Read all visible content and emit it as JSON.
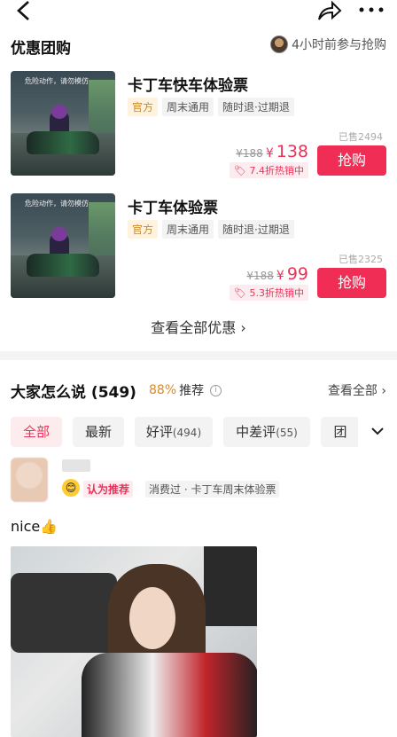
{
  "deals_section": {
    "title": "优惠团购",
    "participant_text": "4小时前参与抢购"
  },
  "deals": [
    {
      "title": "卡丁车快车体验票",
      "tags": [
        "官方",
        "周末通用",
        "随时退·过期退"
      ],
      "sold": "已售2494",
      "original_price": "¥188",
      "currency": "¥",
      "price": "138",
      "discount": "7.4折热销中",
      "button": "抢购",
      "image_warning": "危险动作，请勿模仿"
    },
    {
      "title": "卡丁车体验票",
      "tags": [
        "官方",
        "周末通用",
        "随时退·过期退"
      ],
      "sold": "已售2325",
      "original_price": "¥188",
      "currency": "¥",
      "price": "99",
      "discount": "5.3折热销中",
      "button": "抢购",
      "image_warning": "危险动作，请勿模仿"
    }
  ],
  "view_all_deals": "查看全部优惠 ›",
  "reviews": {
    "title": "大家怎么说 (549)",
    "recommend_pct": "88%",
    "recommend_label": "推荐",
    "view_all": "查看全部 ›",
    "filters": [
      {
        "label": "全部",
        "count": ""
      },
      {
        "label": "最新",
        "count": ""
      },
      {
        "label": "好评",
        "count": "(494)"
      },
      {
        "label": "中差评",
        "count": "(55)"
      },
      {
        "label": "团",
        "count": ""
      }
    ]
  },
  "review_item": {
    "badge": "认为推荐",
    "consumed": "消费过 · 卡丁车周末体验票",
    "text": "nice👍"
  },
  "colors": {
    "accent": "#ef2d55",
    "official": "#c88a2c",
    "recommend": "#d9892a"
  },
  "icons": [
    "back-icon",
    "share-icon",
    "more-icon",
    "info-icon",
    "chevron-down-icon",
    "smile-emoji-icon",
    "fire-tag-icon"
  ]
}
